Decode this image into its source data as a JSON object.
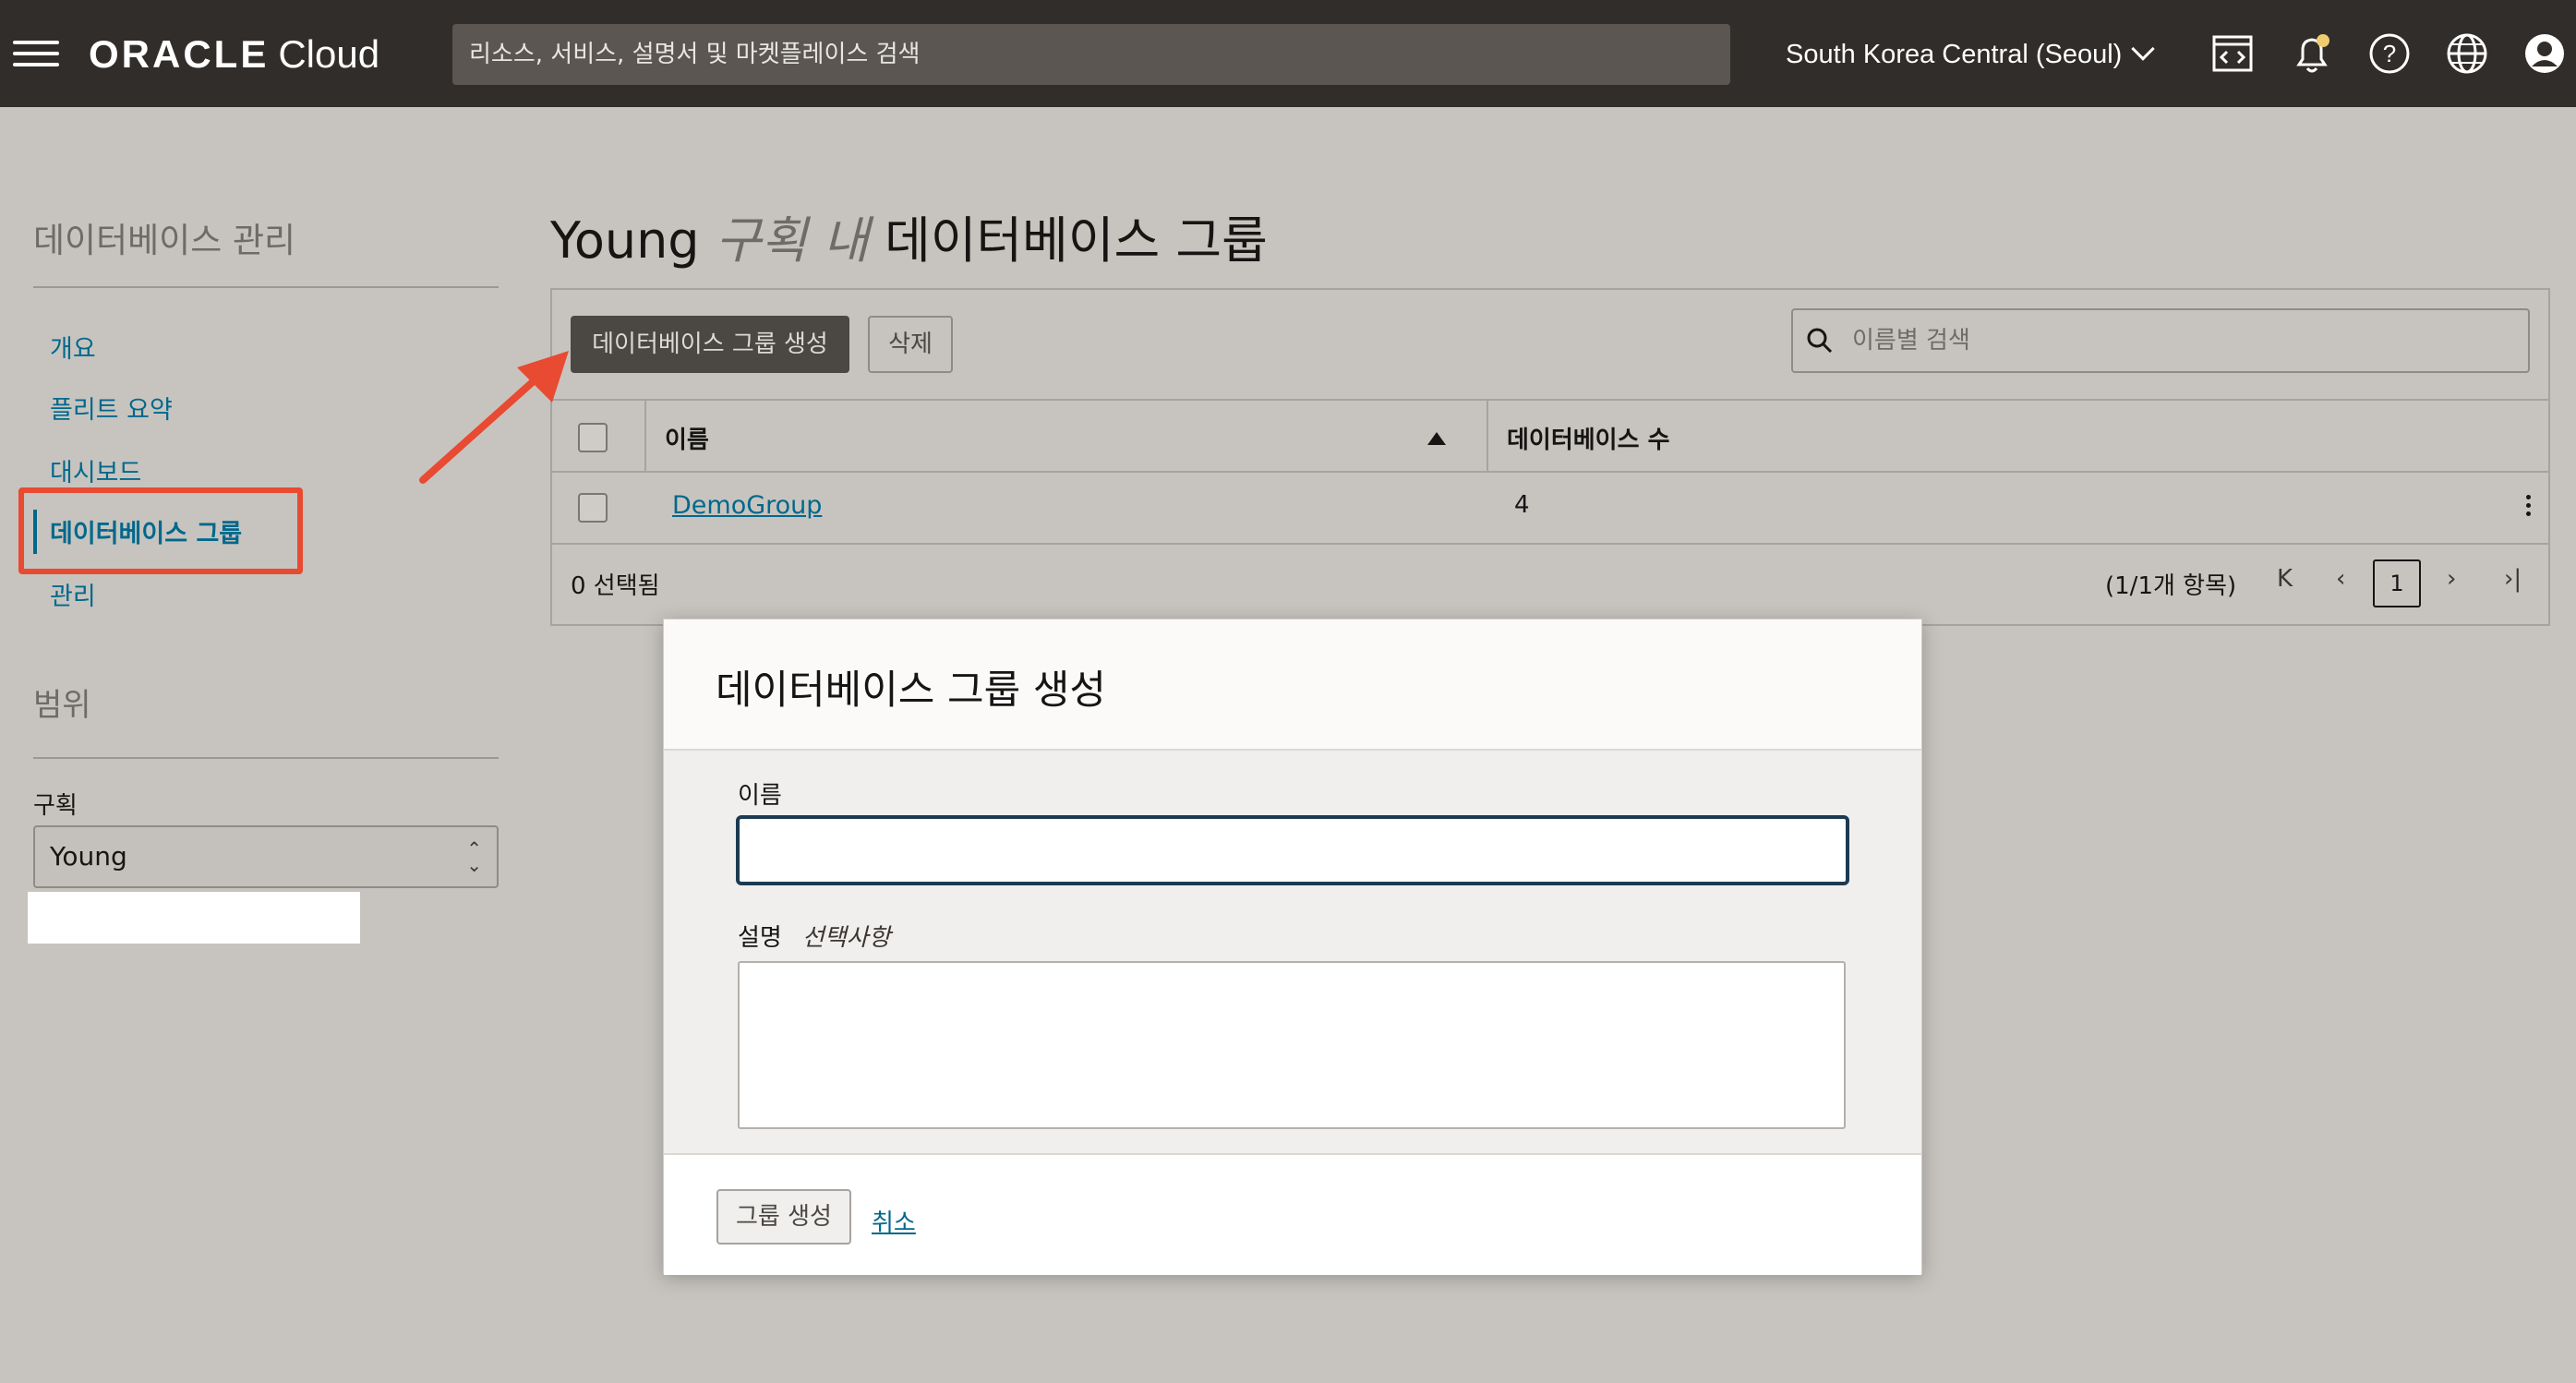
{
  "topbar": {
    "logo_brand": "ORACLE",
    "logo_product": "Cloud",
    "search_placeholder": "리소스, 서비스, 설명서 및 마켓플레이스 검색",
    "region": "South Korea Central (Seoul)",
    "icons": [
      "menu-icon",
      "cloud-shell-icon",
      "bell-icon",
      "help-icon",
      "globe-icon",
      "user-icon"
    ]
  },
  "sidebar": {
    "title": "데이터베이스 관리",
    "items": [
      {
        "label": "개요"
      },
      {
        "label": "플리트 요약"
      },
      {
        "label": "대시보드"
      },
      {
        "label": "데이터베이스 그룹",
        "active": true
      },
      {
        "label": "관리"
      }
    ],
    "scope_title": "범위",
    "compartment_label": "구획",
    "compartment_value": "Young"
  },
  "main": {
    "title_prefix": "Young",
    "title_italic": "구획 내",
    "title_suffix": "데이터베이스 그룹",
    "create_button": "데이터베이스 그룹 생성",
    "delete_button": "삭제",
    "search_placeholder": "이름별 검색",
    "table": {
      "headers": [
        "이름",
        "데이터베이스 수"
      ],
      "rows": [
        {
          "name": "DemoGroup",
          "db_count": "4"
        }
      ]
    },
    "selected_text": "0 선택됨",
    "count_text": "(1/1개 항목)",
    "current_page": "1"
  },
  "dialog": {
    "title": "데이터베이스 그룹 생성",
    "name_label": "이름",
    "name_value": "",
    "desc_label": "설명",
    "desc_optional": "선택사항",
    "desc_value": "",
    "submit_button": "그룹 생성",
    "cancel_link": "취소"
  },
  "colors": {
    "topbar": "#312d2a",
    "link": "#00688c",
    "highlight": "#e84a32"
  }
}
